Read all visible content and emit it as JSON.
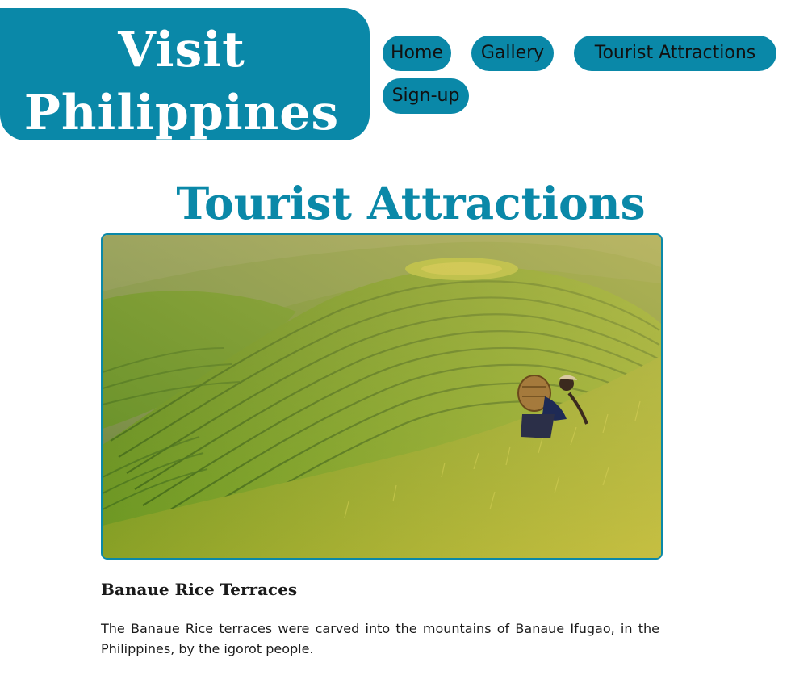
{
  "site": {
    "logo_line1": "Visit",
    "logo_line2": "Philippines"
  },
  "nav": {
    "home": "Home",
    "gallery": "Gallery",
    "tourist_attractions": "Tourist Attractions",
    "signup": "Sign-up"
  },
  "main": {
    "title": "Tourist Attractions",
    "image_label": "rice-terraces-photo",
    "section_title": "Banaue Rice Terraces",
    "description": "The Banaue Rice terraces were carved into the mountains of Banaue Ifugao, in the Philippines, by the igorot people."
  },
  "colors": {
    "accent": "#0a88a8",
    "text": "#1a1a1a",
    "background": "#ffffff"
  }
}
